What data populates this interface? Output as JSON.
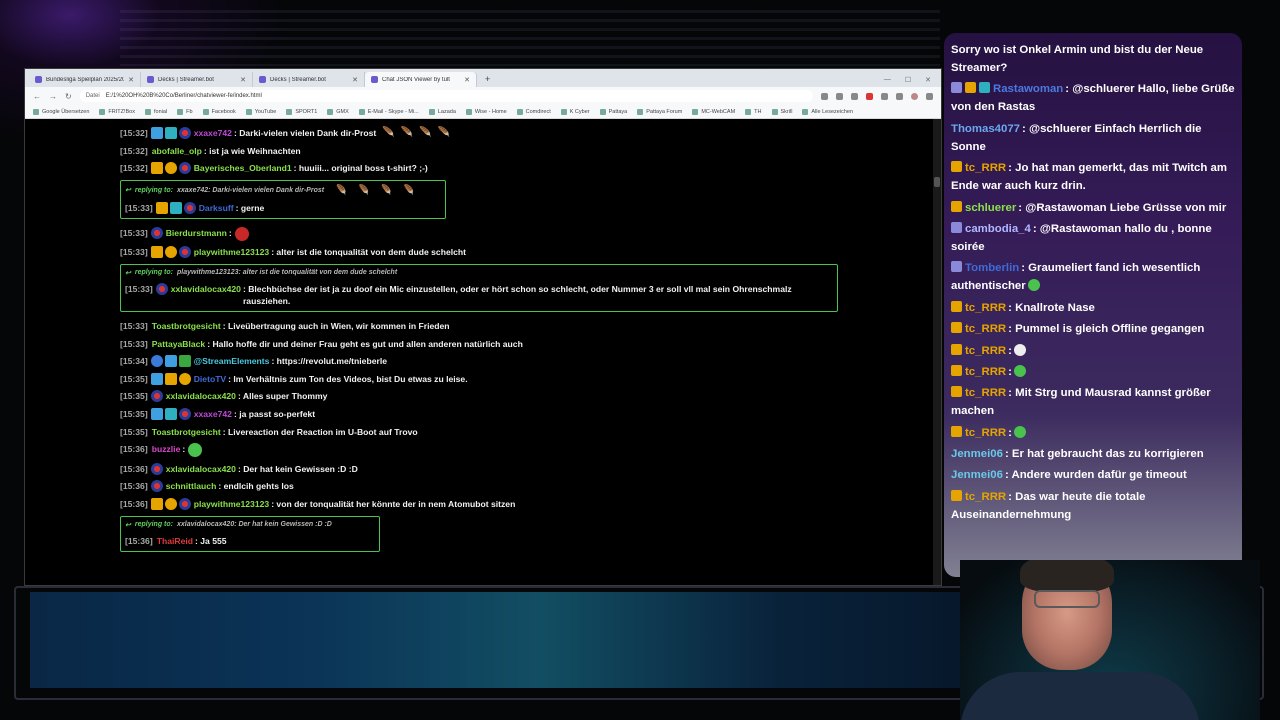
{
  "browser": {
    "tabs": [
      {
        "label": "Bundesliga Spielplan 2025/202..."
      },
      {
        "label": "Decks | Streamer.bot"
      },
      {
        "label": "Decks | Streamer.bot"
      },
      {
        "label": "Chat JSON Viewer by tult",
        "active": true
      }
    ],
    "new_tab": "+",
    "address": {
      "scheme": "Datei",
      "url": "E:/1%20OH%20B%20Co/Berliner/chatviewer-fe/index.html"
    },
    "bookmarks": [
      "Google Übersetzen",
      "FRITZ!Box",
      "fonial",
      "Fb",
      "Facebook",
      "YouTube",
      "SPORT1",
      "GMX",
      "E-Mail - Skype - Mi...",
      "Lazada",
      "Wise - Home",
      "Comdirect",
      "K Cyber",
      "Pattaya",
      "Pattaya Forum",
      "MC-WebCAM",
      "TH",
      "Skrill",
      "Alle Lesezeichen"
    ]
  },
  "chat": [
    {
      "time": "[15:32]",
      "badges": [
        "sub",
        "grid",
        "flag"
      ],
      "user": "xxaxe742",
      "color": "#c048d8",
      "text": ": Darki-vielen vielen Dank dir-Prost",
      "feathers": 4
    },
    {
      "time": "[15:32]",
      "badges": [],
      "user": "abofalle_olp",
      "color": "#8be04b",
      "text": ": ist ja wie Weihnachten"
    },
    {
      "time": "[15:32]",
      "badges": [
        "vip",
        "gold",
        "flag"
      ],
      "user": "Bayerisches_Oberland1",
      "color": "#8be04b",
      "text": ": huuiii... original boss t-shirt? ;-)"
    },
    {
      "reply": true,
      "reply_label": "replying to:",
      "reply_text": "xxaxe742: Darki-vielen vielen Dank dir-Prost",
      "reply_feathers": 4,
      "time": "[15:33]",
      "badges": [
        "vip",
        "grid",
        "flag"
      ],
      "user": "Darksuff",
      "color": "#3e6bd8",
      "text": ": gerne",
      "box_width": 326
    },
    {
      "time": "[15:33]",
      "badges": [
        "flag"
      ],
      "user": "Bierdurstmann",
      "color": "#8be04b",
      "text": ":",
      "emote": "red"
    },
    {
      "time": "[15:33]",
      "badges": [
        "vip",
        "gold",
        "flag"
      ],
      "user": "playwithme123123",
      "color": "#8be04b",
      "text": ": alter ist die tonqualität von dem dude schelcht"
    },
    {
      "reply": true,
      "reply_label": "replying to:",
      "reply_text": "playwithme123123: alter ist die tonqualität von dem dude schelcht",
      "time": "[15:33]",
      "badges": [
        "flag"
      ],
      "user": "xxlavidalocax420",
      "color": "#8be04b",
      "text": ": Blechbüchse der ist ja zu doof ein Mic einzustellen, oder er hört schon so schlecht, oder Nummer 3 er soll vll mal sein Ohrenschmalz rausziehen.",
      "box_width": 718
    },
    {
      "time": "[15:33]",
      "badges": [],
      "user": "Toastbrotgesicht",
      "color": "#8be04b",
      "text": ": Liveübertragung auch in Wien, wir kommen in Frieden"
    },
    {
      "time": "[15:33]",
      "badges": [],
      "user": "PattayaBlack",
      "color": "#8be04b",
      "text": ": Hallo hoffe dir und deiner Frau geht es gut und allen anderen natürlich auch"
    },
    {
      "time": "[15:34]",
      "badges": [
        "bot",
        "sub",
        "mod"
      ],
      "user": "@StreamElements",
      "color": "#4ac8e0",
      "text": ": https://revolut.me/tnieberle"
    },
    {
      "time": "[15:35]",
      "badges": [
        "sub",
        "vip",
        "gold"
      ],
      "user": "DietoTV",
      "color": "#3e6bd8",
      "text": ": Im Verhältnis zum Ton des Videos, bist Du etwas zu leise."
    },
    {
      "time": "[15:35]",
      "badges": [
        "flag"
      ],
      "user": "xxlavidalocax420",
      "color": "#8be04b",
      "text": ": Alles super Thommy"
    },
    {
      "time": "[15:35]",
      "badges": [
        "sub",
        "grid",
        "flag"
      ],
      "user": "xxaxe742",
      "color": "#c048d8",
      "text": ": ja passt so-perfekt"
    },
    {
      "time": "[15:35]",
      "badges": [],
      "user": "Toastbrotgesicht",
      "color": "#8be04b",
      "text": ": Livereaction der Reaction im U-Boot auf Trovo"
    },
    {
      "time": "[15:36]",
      "badges": [],
      "user": "buzzlie",
      "color": "#d848c8",
      "text": ":",
      "emote": "green"
    },
    {
      "time": "[15:36]",
      "badges": [
        "flag"
      ],
      "user": "xxlavidalocax420",
      "color": "#8be04b",
      "text": ": Der hat kein Gewissen :D :D"
    },
    {
      "time": "[15:36]",
      "badges": [
        "flag"
      ],
      "user": "schnittlauch",
      "color": "#8be04b",
      "text": ": endlcih gehts los"
    },
    {
      "time": "[15:36]",
      "badges": [
        "vip",
        "gold",
        "flag"
      ],
      "user": "playwithme123123",
      "color": "#8be04b",
      "text": ": von der tonqualität her könnte der in nem Atomubot sitzen"
    },
    {
      "reply": true,
      "reply_label": "replying to:",
      "reply_text": "xxlavidalocax420: Der hat kein Gewissen :D :D",
      "time": "[15:36]",
      "badges": [],
      "user": "ThaiReid",
      "color": "#e03a3a",
      "text": ": Ja 555",
      "box_width": 260
    }
  ],
  "overlay": [
    {
      "badges": [],
      "user": "",
      "color": "#ffffff",
      "text": "Sorry wo ist Onkel Armin und bist du der Neue Streamer?"
    },
    {
      "badges": [
        "mod",
        "gold",
        "grid"
      ],
      "user": "Rastawoman",
      "color": "#4a7ae0",
      "text": ": @schluerer Hallo, liebe Grüße von den Rastas"
    },
    {
      "badges": [],
      "user": "Thomas4077",
      "color": "#6aa8f0",
      "text": ": @schluerer Einfach Herrlich die Sonne"
    },
    {
      "badges": [
        "vip"
      ],
      "user": "tc_RRR",
      "color": "#e6a400",
      "text": ": Jo hat man gemerkt, das mit Twitch am Ende war auch kurz drin."
    },
    {
      "badges": [
        "vip"
      ],
      "user": "schluerer",
      "color": "#8be04b",
      "text": ": @Rastawoman Liebe Grüsse von mir"
    },
    {
      "badges": [
        "mod"
      ],
      "user": "cambodia_4",
      "color": "#b0b8ff",
      "text": ": @Rastawoman hallo du , bonne soirée"
    },
    {
      "badges": [
        "mod"
      ],
      "user": "Tomberlin",
      "color": "#3e6bd8",
      "text": ": Graumeliert fand ich wesentlich authentischer",
      "emote": "green"
    },
    {
      "badges": [
        "vip"
      ],
      "user": "tc_RRR",
      "color": "#e6a400",
      "text": ": Knallrote Nase"
    },
    {
      "badges": [
        "vip"
      ],
      "user": "tc_RRR",
      "color": "#e6a400",
      "text": ": Pummel is gleich Offline gegangen"
    },
    {
      "badges": [
        "vip"
      ],
      "user": "tc_RRR",
      "color": "#e6a400",
      "text": ":",
      "emote": "white"
    },
    {
      "badges": [
        "vip"
      ],
      "user": "tc_RRR",
      "color": "#e6a400",
      "text": ":",
      "emote": "green"
    },
    {
      "badges": [
        "vip"
      ],
      "user": "tc_RRR",
      "color": "#e6a400",
      "text": ": Mit Strg und Mausrad kannst größer machen"
    },
    {
      "badges": [
        "vip"
      ],
      "user": "tc_RRR",
      "color": "#e6a400",
      "text": ":",
      "emote": "green"
    },
    {
      "badges": [],
      "user": "Jenmei06",
      "color": "#6ac8e8",
      "text": ": Er hat gebraucht das zu korrigieren"
    },
    {
      "badges": [],
      "user": "Jenmei06",
      "color": "#6ac8e8",
      "text": ": Andere wurden dafür ge timeout"
    },
    {
      "badges": [
        "vip"
      ],
      "user": "tc_RRR",
      "color": "#e6a400",
      "text": ": Das war heute die totale Auseinandernehmung"
    }
  ],
  "colors": {
    "reply_border": "#4ec24e",
    "timestamp": "#a8a8a8",
    "chat_bg": "#000000",
    "overlay_top": "#28124a"
  }
}
